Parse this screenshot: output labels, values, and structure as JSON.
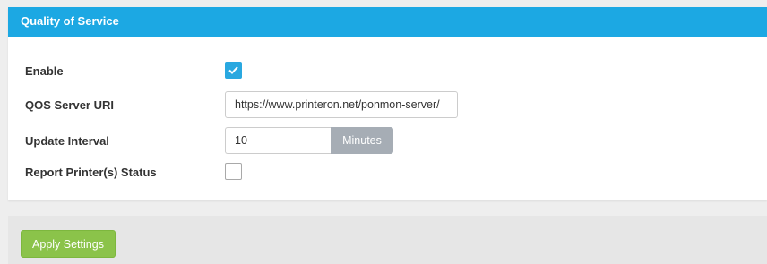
{
  "panel": {
    "title": "Quality of Service"
  },
  "form": {
    "enable": {
      "label": "Enable",
      "checked": true
    },
    "qos_server_uri": {
      "label": "QOS Server URI",
      "value": "https://www.printeron.net/ponmon-server/"
    },
    "update_interval": {
      "label": "Update Interval",
      "value": "10",
      "unit": "Minutes"
    },
    "report_printer_status": {
      "label": "Report Printer(s) Status",
      "checked": false
    }
  },
  "footer": {
    "apply_label": "Apply Settings"
  },
  "colors": {
    "header_bg": "#1ca8e3",
    "checkbox_checked": "#29a8e0",
    "addon_bg": "#a6adb5",
    "apply_button": "#8bc34a"
  },
  "icons": {
    "enable_checkbox": "checkmark-icon"
  }
}
